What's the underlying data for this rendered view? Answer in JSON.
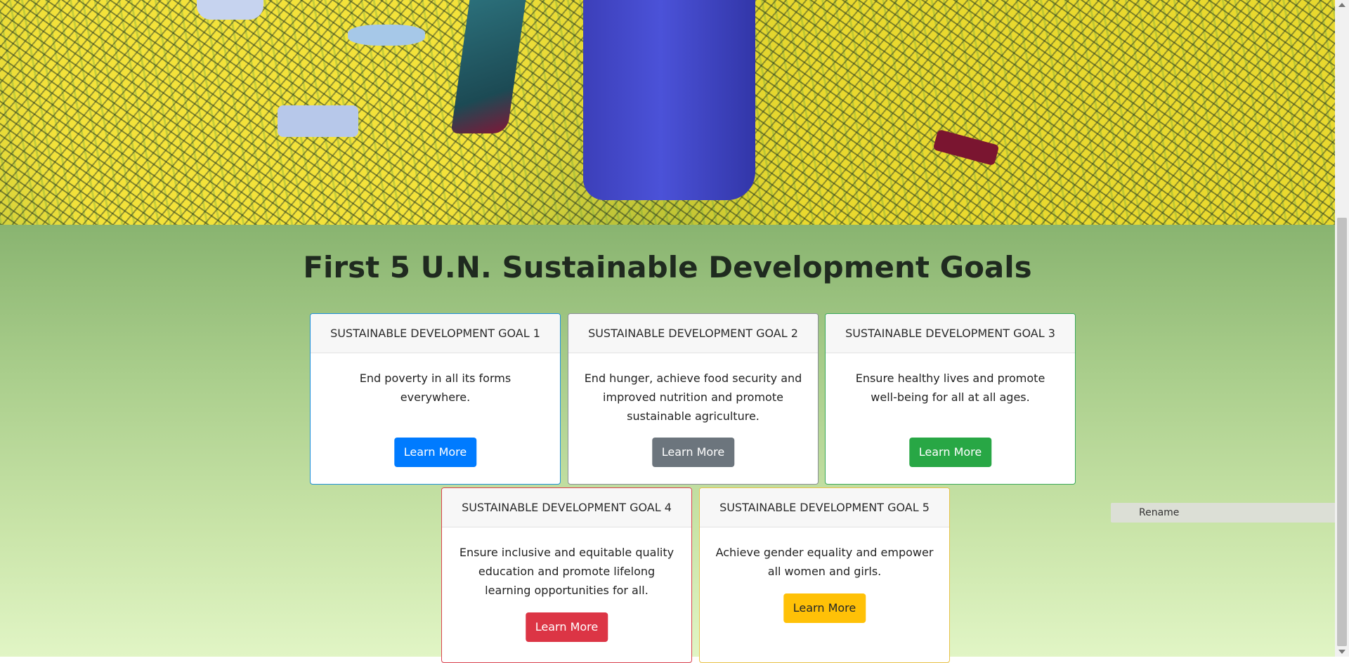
{
  "section": {
    "title": "First 5 U.N. Sustainable Development Goals"
  },
  "goals": [
    {
      "header": "SUSTAINABLE DEVELOPMENT GOAL 1",
      "text": "End poverty in all its forms everywhere.",
      "button": "Learn More",
      "color": "#007bff"
    },
    {
      "header": "SUSTAINABLE DEVELOPMENT GOAL 2",
      "text": "End hunger, achieve food security and improved nutrition and promote sustainable agriculture.",
      "button": "Learn More",
      "color": "#6c757d"
    },
    {
      "header": "SUSTAINABLE DEVELOPMENT GOAL 3",
      "text": "Ensure healthy lives and promote well-being for all at all ages.",
      "button": "Learn More",
      "color": "#28a745"
    },
    {
      "header": "SUSTAINABLE DEVELOPMENT GOAL 4",
      "text": "Ensure inclusive and equitable quality education and promote lifelong learning opportunities for all.",
      "button": "Learn More",
      "color": "#dc3545"
    },
    {
      "header": "SUSTAINABLE DEVELOPMENT GOAL 5",
      "text": "Achieve gender equality and empower all women and girls.",
      "button": "Learn More",
      "color": "#ffc107"
    }
  ],
  "context_menu": {
    "rename_label": "Rename"
  }
}
